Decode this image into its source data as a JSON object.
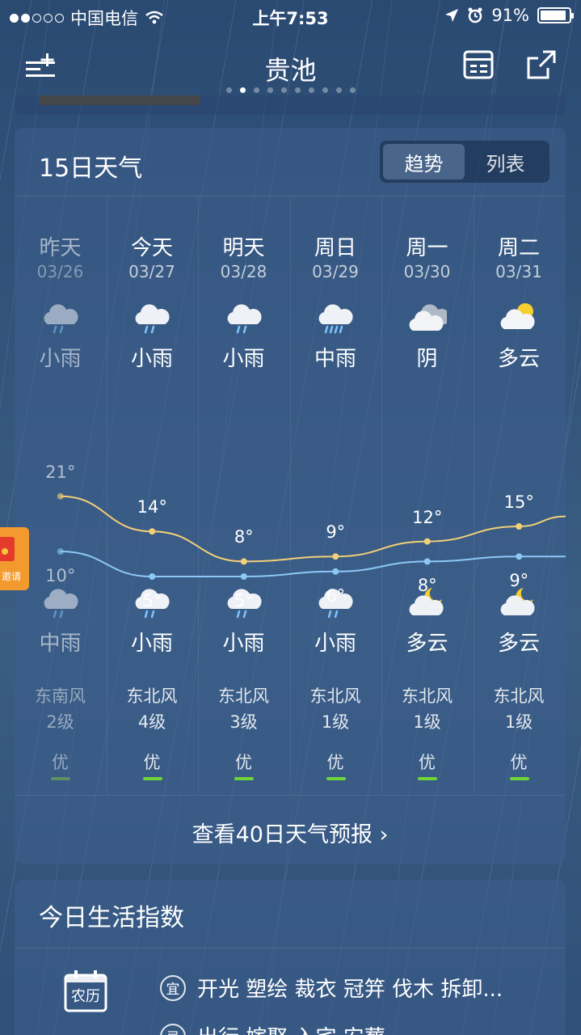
{
  "status_bar": {
    "carrier": "中国电信",
    "time": "上午7:53",
    "battery": "91%",
    "battery_level": 0.91
  },
  "nav": {
    "city": "贵池",
    "page_count": 10,
    "active_page": 1
  },
  "forecast": {
    "title": "15日天气",
    "toggle": {
      "trend": "趋势",
      "list": "列表",
      "active": "trend"
    },
    "more_link": "查看40日天气预报 ›",
    "days": [
      {
        "name": "昨天",
        "date": "03/26",
        "day_icon": "rain-cloud-icon",
        "day_cond": "小雨",
        "high": "21°",
        "low": "10°",
        "night_icon": "rain-cloud-icon",
        "night_cond": "中雨",
        "wind_dir": "东南风",
        "wind_level": "2级",
        "aqi": "优",
        "past": true
      },
      {
        "name": "今天",
        "date": "03/27",
        "day_icon": "rain-cloud-icon",
        "day_cond": "小雨",
        "high": "14°",
        "low": "5°",
        "night_icon": "rain-cloud-icon",
        "night_cond": "小雨",
        "wind_dir": "东北风",
        "wind_level": "4级",
        "aqi": "优",
        "past": false
      },
      {
        "name": "明天",
        "date": "03/28",
        "day_icon": "rain-cloud-icon",
        "day_cond": "小雨",
        "high": "8°",
        "low": "5°",
        "night_icon": "rain-cloud-icon",
        "night_cond": "小雨",
        "wind_dir": "东北风",
        "wind_level": "3级",
        "aqi": "优",
        "past": false
      },
      {
        "name": "周日",
        "date": "03/29",
        "day_icon": "heavy-rain-cloud-icon",
        "day_cond": "中雨",
        "high": "9°",
        "low": "6°",
        "night_icon": "rain-cloud-icon",
        "night_cond": "小雨",
        "wind_dir": "东北风",
        "wind_level": "1级",
        "aqi": "优",
        "past": false
      },
      {
        "name": "周一",
        "date": "03/30",
        "day_icon": "overcast-icon",
        "day_cond": "阴",
        "high": "12°",
        "low": "8°",
        "night_icon": "moon-cloud-icon",
        "night_cond": "多云",
        "wind_dir": "东北风",
        "wind_level": "1级",
        "aqi": "优",
        "past": false
      },
      {
        "name": "周二",
        "date": "03/31",
        "day_icon": "sun-cloud-icon",
        "day_cond": "多云",
        "high": "15°",
        "low": "9°",
        "night_icon": "moon-cloud-icon",
        "night_cond": "多云",
        "wind_dir": "东北风",
        "wind_level": "1级",
        "aqi": "优",
        "past": false
      }
    ],
    "colors": {
      "high_line": "#f3cf78",
      "low_line": "#8cc8f5",
      "aqi_good": "#6fd33a"
    }
  },
  "chart_data": {
    "type": "line",
    "categories": [
      "03/26",
      "03/27",
      "03/28",
      "03/29",
      "03/30",
      "03/31"
    ],
    "series": [
      {
        "values": [
          21,
          14,
          8,
          9,
          12,
          15
        ]
      },
      {
        "values": [
          10,
          5,
          5,
          6,
          8,
          9
        ]
      }
    ]
  },
  "life": {
    "title": "今日生活指数",
    "calendar_label": "农历",
    "yi_label": "宜",
    "yi_items": "开光 塑绘 裁衣 冠笄 伐木 拆卸...",
    "ji_label": "忌",
    "ji_items": "出行 嫁娶 入宅 安葬"
  },
  "invite": {
    "label": "邀请"
  }
}
